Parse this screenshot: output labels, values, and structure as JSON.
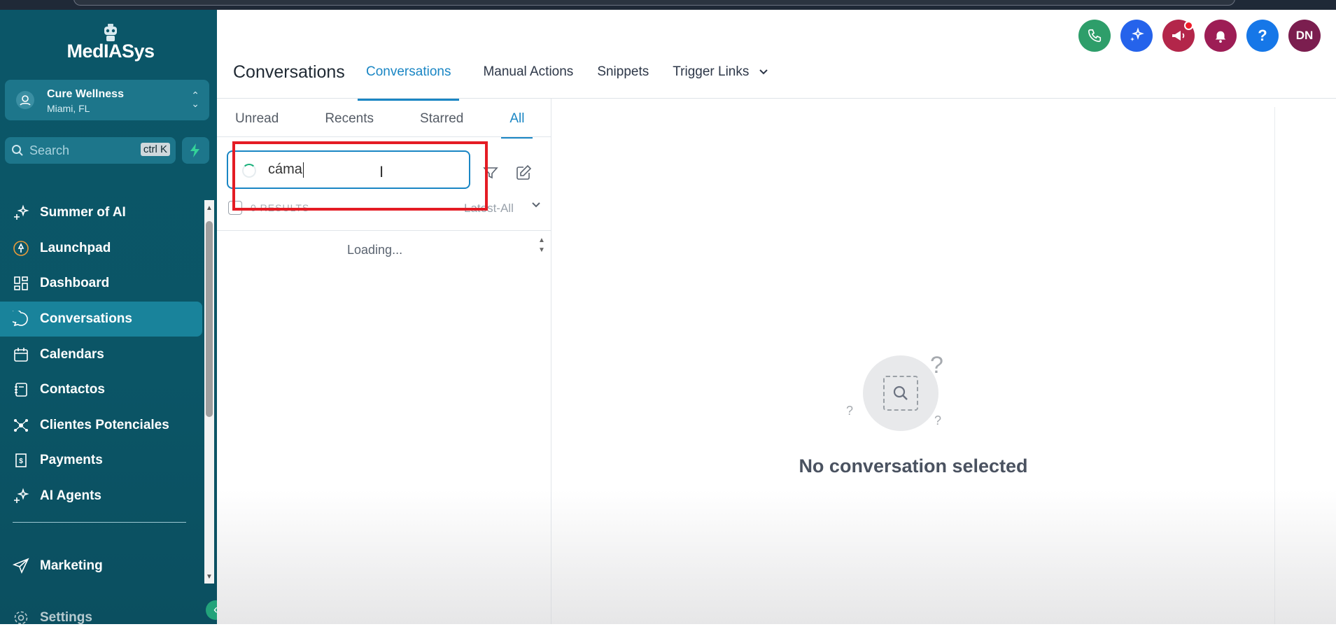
{
  "app": {
    "brand": "MedIASys",
    "location": {
      "name": "Cure Wellness",
      "city": "Miami, FL"
    },
    "search": {
      "label": "Search",
      "shortcut": "ctrl K"
    }
  },
  "sidebar": {
    "items": [
      {
        "label": "Summer of AI",
        "icon": "sparkle-icon"
      },
      {
        "label": "Launchpad",
        "icon": "rocket-icon"
      },
      {
        "label": "Dashboard",
        "icon": "grid-icon"
      },
      {
        "label": "Conversations",
        "icon": "chat-bubble-icon",
        "active": true
      },
      {
        "label": "Calendars",
        "icon": "calendar-icon"
      },
      {
        "label": "Contactos",
        "icon": "contact-book-icon"
      },
      {
        "label": "Clientes Potenciales",
        "icon": "network-icon"
      },
      {
        "label": "Payments",
        "icon": "receipt-icon"
      },
      {
        "label": "AI Agents",
        "icon": "sparkle-icon"
      }
    ],
    "marketing": "Marketing",
    "settings": "Settings"
  },
  "header": {
    "title": "Conversations",
    "tabs": [
      {
        "label": "Conversations",
        "active": true
      },
      {
        "label": "Manual Actions"
      },
      {
        "label": "Snippets"
      },
      {
        "label": "Trigger Links"
      }
    ],
    "avatar_initials": "DN",
    "help": "?"
  },
  "list": {
    "subtabs": [
      "Unread",
      "Recents",
      "Starred",
      "All"
    ],
    "search_value": "cáma",
    "results": "0 RESULTS",
    "sort": "Latest-All",
    "loading": "Loading..."
  },
  "detail": {
    "empty_title": "No conversation selected"
  },
  "colors": {
    "sidebar": "#0b5668",
    "accent": "#1a86c4",
    "highlight_box": "#e41c24",
    "phone": "#2e9e6a",
    "ai": "#2563eb",
    "megaphone": "#b3264a",
    "bell": "#9d1d55",
    "help": "#1677e8",
    "avatar": "#7b1e4f"
  }
}
